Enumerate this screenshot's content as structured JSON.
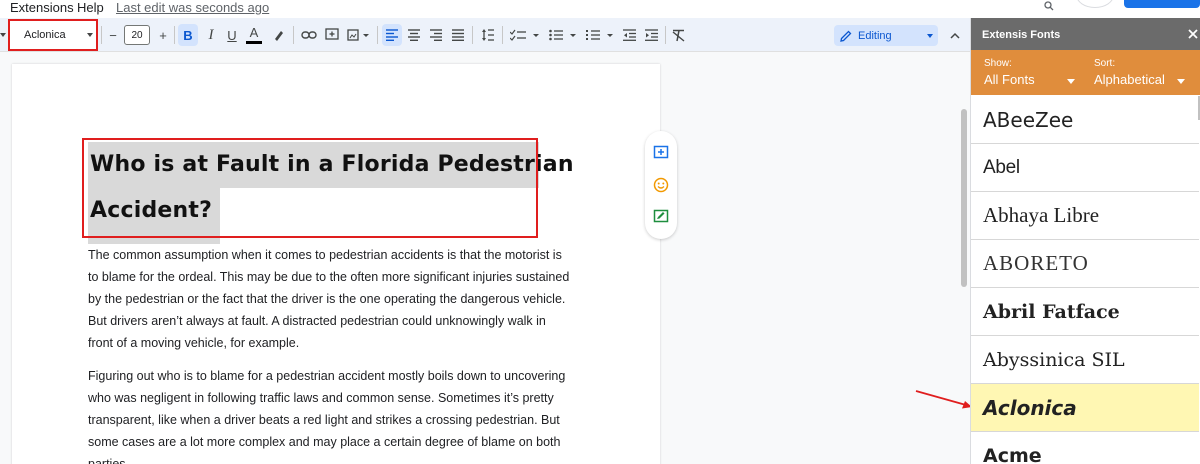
{
  "menubar": {
    "extensions": "Extensions",
    "help": "Help",
    "last_edit": "Last edit was seconds ago"
  },
  "toolbar": {
    "font_name": "Aclonica",
    "font_size": "20",
    "decrease_size": "−",
    "increase_size": "+",
    "bold": "B",
    "italic": "I",
    "underline": "U",
    "text_color": "A",
    "editing_mode": "Editing"
  },
  "document": {
    "heading_line_1": "Who is at Fault in a Florida Pedestrian",
    "heading_line_2": "Accident?",
    "paragraph_1": [
      "The common assumption when it comes to pedestrian accidents is that the motorist is",
      "to blame for the ordeal. This may be due to the often more significant injuries sustained",
      "by the pedestrian or the fact that the driver is the one operating the dangerous vehicle.",
      "But drivers aren’t always at fault. A distracted pedestrian could unknowingly walk in",
      "front of a moving vehicle, for example."
    ],
    "paragraph_2": [
      "Figuring out who is to blame for a pedestrian accident mostly boils down to uncovering",
      "who was negligent in following traffic laws and common sense. Sometimes it’s pretty",
      "transparent, like when a driver beats a red light and strikes a crossing pedestrian. But",
      "some cases are a lot more complex and may place a certain degree of blame on both",
      "parties."
    ]
  },
  "extension_panel": {
    "title": "Extensis Fonts",
    "show_label": "Show:",
    "show_value": "All Fonts",
    "sort_label": "Sort:",
    "sort_value": "Alphabetical",
    "fonts": [
      "ABeeZee",
      "Abel",
      "Abhaya Libre",
      "ABORETO",
      "Abril Fatface",
      "Abyssinica  SIL",
      "Aclonica",
      "Acme"
    ],
    "selected_font": "Aclonica"
  },
  "colors": {
    "highlight_border": "#e01e1e",
    "panel_header": "#6b6b6b",
    "panel_filter_bar": "#e08d3c",
    "selected_font_bg": "#fff7b3",
    "accent_blue": "#0b57d0"
  },
  "icons": [
    "link-icon",
    "comment-icon",
    "image-icon",
    "line-spacing-icon",
    "checklist-icon",
    "bullet-list-icon",
    "numbered-list-icon",
    "indent-icon",
    "clear-format-icon",
    "pencil-icon",
    "close-icon",
    "smiley-icon"
  ]
}
